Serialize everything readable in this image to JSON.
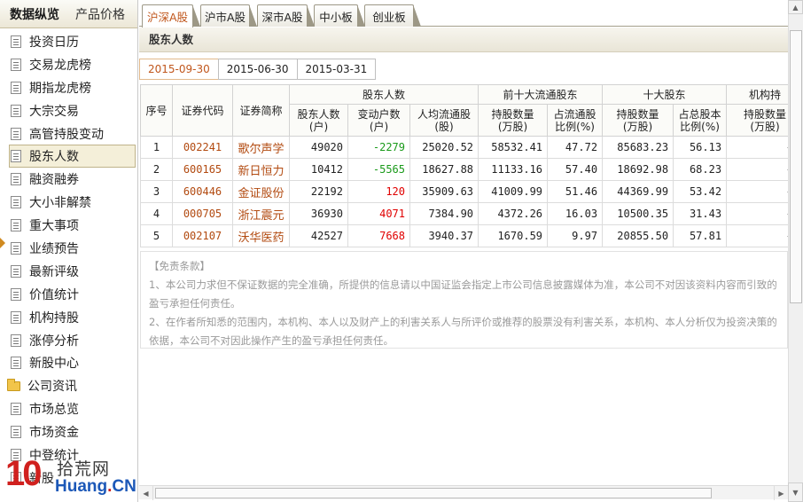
{
  "left_tabs": [
    "数据纵览",
    "产品价格"
  ],
  "nav": [
    {
      "label": "投资日历",
      "icon": "document-icon"
    },
    {
      "label": "交易龙虎榜",
      "icon": "document-icon"
    },
    {
      "label": "期指龙虎榜",
      "icon": "document-icon"
    },
    {
      "label": "大宗交易",
      "icon": "document-icon"
    },
    {
      "label": "高管持股变动",
      "icon": "document-icon"
    },
    {
      "label": "股东人数",
      "icon": "document-icon",
      "selected": true
    },
    {
      "label": "融资融券",
      "icon": "document-icon"
    },
    {
      "label": "大小非解禁",
      "icon": "document-icon"
    },
    {
      "label": "重大事项",
      "icon": "document-icon"
    },
    {
      "label": "业绩预告",
      "icon": "document-icon"
    },
    {
      "label": "最新评级",
      "icon": "document-icon"
    },
    {
      "label": "价值统计",
      "icon": "document-icon"
    },
    {
      "label": "机构持股",
      "icon": "document-icon"
    },
    {
      "label": "涨停分析",
      "icon": "document-icon"
    },
    {
      "label": "新股中心",
      "icon": "document-icon"
    },
    {
      "label": "公司资讯",
      "icon": "folder-icon"
    },
    {
      "label": "市场总览",
      "icon": "document-icon"
    },
    {
      "label": "市场资金",
      "icon": "document-icon"
    },
    {
      "label": "中登统计",
      "icon": "document-icon"
    },
    {
      "label": "新股",
      "icon": "document-icon"
    }
  ],
  "watermark": {
    "num": "10",
    "cn": "拾荒网",
    "url_a": "Huang",
    "url_dot": ".",
    "url_b": "CN"
  },
  "market_tabs": [
    "沪深A股",
    "沪市A股",
    "深市A股",
    "中小板",
    "创业板"
  ],
  "section_title": "股东人数",
  "date_tabs": [
    "2015-09-30",
    "2015-06-30",
    "2015-03-31"
  ],
  "table": {
    "group_headers": {
      "holders": "股东人数",
      "top10_float": "前十大流通股东",
      "top10": "十大股东",
      "inst": "机构持"
    },
    "col_headers": {
      "seq": "序号",
      "code": "证券代码",
      "name": "证券简称",
      "holders": "股东人数\n(户)",
      "change": "变动户数\n(户)",
      "per_float": "人均流通股\n(股)",
      "f_qty": "持股数量\n(万股)",
      "f_ratio": "占流通股\n比例(%)",
      "t_qty": "持股数量\n(万股)",
      "t_ratio": "占总股本\n比例(%)",
      "i_qty": "持股数量\n(万股)"
    },
    "rows": [
      {
        "seq": "1",
        "code": "002241",
        "name": "歌尔声学",
        "holders": "49020",
        "change": "-2279",
        "change_sign": "neg",
        "per_float": "25020.52",
        "f_qty": "58532.41",
        "f_ratio": "47.72",
        "t_qty": "85683.23",
        "t_ratio": "56.13",
        "i_qty": "--"
      },
      {
        "seq": "2",
        "code": "600165",
        "name": "新日恒力",
        "holders": "10412",
        "change": "-5565",
        "change_sign": "neg",
        "per_float": "18627.88",
        "f_qty": "11133.16",
        "f_ratio": "57.40",
        "t_qty": "18692.98",
        "t_ratio": "68.23",
        "i_qty": "--"
      },
      {
        "seq": "3",
        "code": "600446",
        "name": "金证股份",
        "holders": "22192",
        "change": "120",
        "change_sign": "pos",
        "per_float": "35909.63",
        "f_qty": "41009.99",
        "f_ratio": "51.46",
        "t_qty": "44369.99",
        "t_ratio": "53.42",
        "i_qty": "--"
      },
      {
        "seq": "4",
        "code": "000705",
        "name": "浙江震元",
        "holders": "36930",
        "change": "4071",
        "change_sign": "pos",
        "per_float": "7384.90",
        "f_qty": "4372.26",
        "f_ratio": "16.03",
        "t_qty": "10500.35",
        "t_ratio": "31.43",
        "i_qty": "--"
      },
      {
        "seq": "5",
        "code": "002107",
        "name": "沃华医药",
        "holders": "42527",
        "change": "7668",
        "change_sign": "pos",
        "per_float": "3940.37",
        "f_qty": "1670.59",
        "f_ratio": "9.97",
        "t_qty": "20855.50",
        "t_ratio": "57.81",
        "i_qty": "--"
      }
    ]
  },
  "disclaimer": {
    "title": "【免责条款】",
    "p1": "1、本公司力求但不保证数据的完全准确，所提供的信息请以中国证监会指定上市公司信息披露媒体为准，本公司不对因该资料内容而引致的盈亏承担任何责任。",
    "p2": "2、在作者所知悉的范围内，本机构、本人以及财产上的利害关系人与所评价或推荐的股票没有利害关系，本机构、本人分析仅为投资决策的依据，本公司不对因此操作产生的盈亏承担任何责任。"
  },
  "colors": {
    "accent": "#c0561c",
    "negative": "#1a9a1a",
    "positive": "#e00000",
    "link": "#b24a10"
  }
}
